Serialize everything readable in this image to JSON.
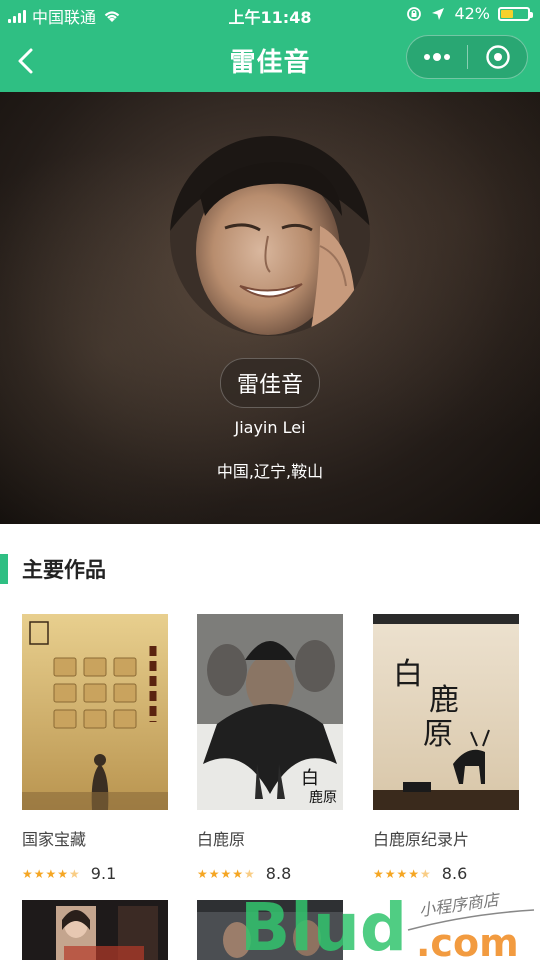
{
  "status_bar": {
    "carrier": "中国联通",
    "time": "上午11:48",
    "battery": "42%",
    "battery_level": 0.42
  },
  "navbar": {
    "title": "雷佳音"
  },
  "profile": {
    "name_zh": "雷佳音",
    "name_en": "Jiayin Lei",
    "birthplace": "中国,辽宁,鞍山"
  },
  "section": {
    "title": "主要作品"
  },
  "works": [
    {
      "title": "国家宝藏",
      "rating": "9.1",
      "stars": 4.5
    },
    {
      "title": "白鹿原",
      "rating": "8.8",
      "stars": 4.5
    },
    {
      "title": "白鹿原纪录片",
      "rating": "8.6",
      "stars": 4.5
    }
  ],
  "colors": {
    "accent": "#2fbf83",
    "star": "#f5a623"
  },
  "watermark": {
    "text_main": "Blud",
    "text_small": "小程序商店",
    "text_suffix": ".com"
  }
}
